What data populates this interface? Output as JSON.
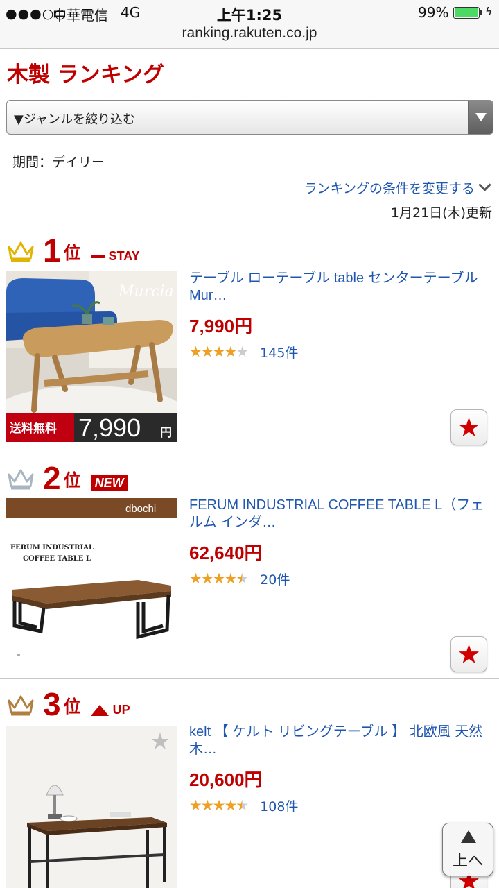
{
  "status_bar": {
    "signal": "●●●○○",
    "carrier": "中華電信",
    "network": "4G",
    "time": "上午1:25",
    "battery_percent": "99%",
    "battery_level": 0.99,
    "url": "ranking.rakuten.co.jp"
  },
  "page": {
    "title": "木製 ランキング",
    "genre_select": "▼ジャンルを絞り込む",
    "period": "期間：デイリー",
    "change_conditions": "ランキングの条件を変更する",
    "updated": "1月21日(木)更新"
  },
  "items": [
    {
      "rank": "1",
      "rank_suffix": "位",
      "trend": "STAY",
      "crown_color": "#e0b400",
      "title": "テーブル ローテーブル table センターテーブル Mur…",
      "price": "7,990円",
      "rating": 4.0,
      "stars": "★★★★★",
      "reviews": "145件",
      "thumb_brand": "Murcia",
      "thumb_badge": "送料無料",
      "thumb_price": "7,990",
      "thumb_price_unit": "円"
    },
    {
      "rank": "2",
      "rank_suffix": "位",
      "trend": "NEW",
      "crown_color": "#a9b5c2",
      "title": "FERUM INDUSTRIAL COFFEE TABLE L（フェルム インダ…",
      "price": "62,640円",
      "rating": 4.5,
      "stars": "★★★★★",
      "reviews": "20件",
      "thumb_brand": "dbochi",
      "thumb_caption_1": "FERUM INDUSTRIAL",
      "thumb_caption_2": "COFFEE TABLE L"
    },
    {
      "rank": "3",
      "rank_suffix": "位",
      "trend": "UP",
      "crown_color": "#b08040",
      "title": "kelt 【 ケルト リビングテーブル 】 北欧風 天然木…",
      "price": "20,600円",
      "rating": 4.5,
      "stars": "★★★★★",
      "reviews": "108件"
    }
  ],
  "ui": {
    "fav_icon": "★",
    "to_top": "上へ"
  }
}
